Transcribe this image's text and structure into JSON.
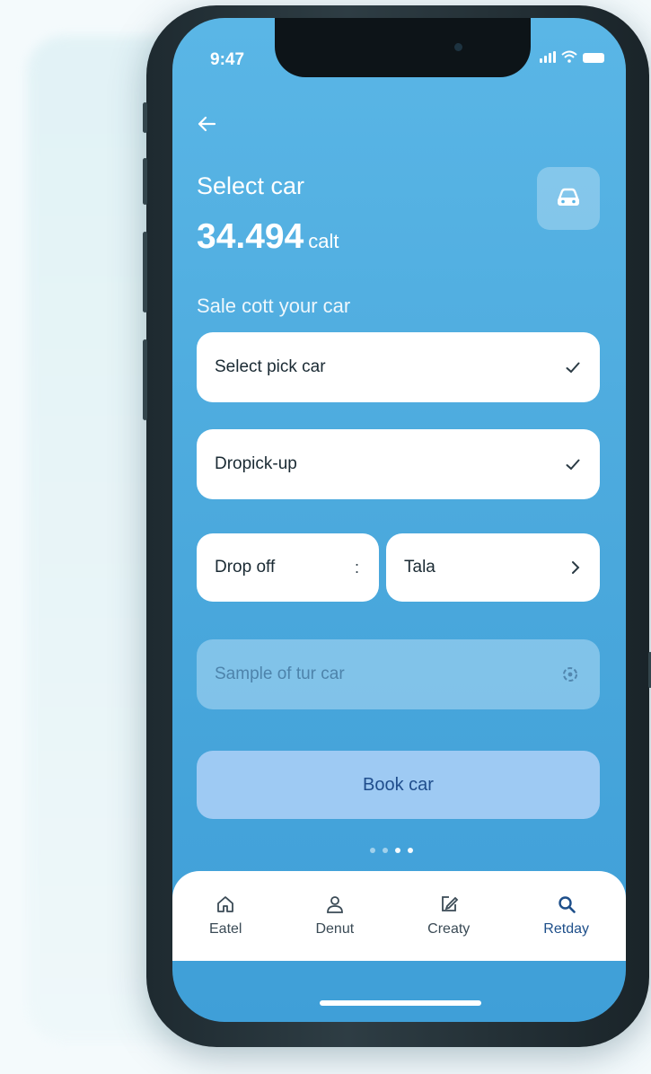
{
  "status": {
    "time": "9:47"
  },
  "header": {
    "title": "Select car",
    "amount": "34.494",
    "amount_unit": "calt",
    "subtitle": "Sale cott your car"
  },
  "form": {
    "pickup": {
      "label": "Select pick car",
      "icon": "check-icon"
    },
    "dropoff_pickup": {
      "label": "Dropick-up",
      "icon": "check-icon"
    },
    "drop_off": {
      "label": "Drop off",
      "control": ":"
    },
    "tala": {
      "label": "Tala",
      "icon": "chevron-right-icon"
    },
    "sample": {
      "placeholder": "Sample of tur car",
      "icon": "settings-icon"
    }
  },
  "actions": {
    "book_label": "Book car"
  },
  "pager": {
    "count": 4,
    "active_index": 3
  },
  "tabs": [
    {
      "label": "Eatel",
      "icon": "home-icon"
    },
    {
      "label": "Denut",
      "icon": "user-icon"
    },
    {
      "label": "Creaty",
      "icon": "edit-icon"
    },
    {
      "label": "Retday",
      "icon": "search-icon"
    }
  ],
  "colors": {
    "screen_top": "#5ab6e6",
    "screen_bottom": "#3f9fd8",
    "book_button": "#9ecaf3",
    "book_text": "#1f4d8c",
    "active_tab": "#1e4f8a"
  }
}
